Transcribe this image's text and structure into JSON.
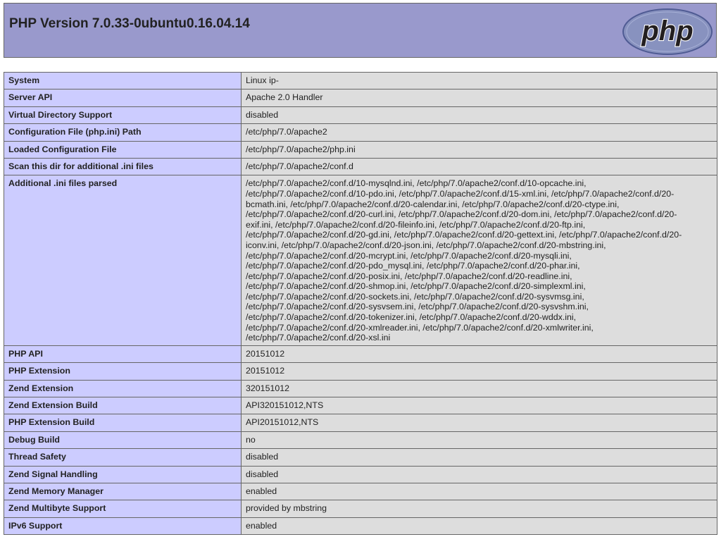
{
  "header": {
    "title": "PHP Version 7.0.33-0ubuntu0.16.04.14",
    "logo_text": "php",
    "colors": {
      "header_bg": "#9999cc",
      "label_bg": "#ccccff",
      "value_bg": "#dddddd",
      "border": "#666666"
    }
  },
  "info_rows": [
    {
      "label": "System",
      "value": "Linux ip-"
    },
    {
      "label": "Server API",
      "value": "Apache 2.0 Handler"
    },
    {
      "label": "Virtual Directory Support",
      "value": "disabled"
    },
    {
      "label": "Configuration File (php.ini) Path",
      "value": "/etc/php/7.0/apache2"
    },
    {
      "label": "Loaded Configuration File",
      "value": "/etc/php/7.0/apache2/php.ini"
    },
    {
      "label": "Scan this dir for additional .ini files",
      "value": "/etc/php/7.0/apache2/conf.d"
    },
    {
      "label": "Additional .ini files parsed",
      "lines": [
        "/etc/php/7.0/apache2/conf.d/10-mysqlnd.ini, /etc/php/7.0/apache2/conf.d/10-opcache.ini,",
        "/etc/php/7.0/apache2/conf.d/10-pdo.ini, /etc/php/7.0/apache2/conf.d/15-xml.ini, /etc/php/7.0/apache2/conf.d/20-",
        "bcmath.ini, /etc/php/7.0/apache2/conf.d/20-calendar.ini, /etc/php/7.0/apache2/conf.d/20-ctype.ini,",
        "/etc/php/7.0/apache2/conf.d/20-curl.ini, /etc/php/7.0/apache2/conf.d/20-dom.ini, /etc/php/7.0/apache2/conf.d/20-",
        "exif.ini, /etc/php/7.0/apache2/conf.d/20-fileinfo.ini, /etc/php/7.0/apache2/conf.d/20-ftp.ini,",
        "/etc/php/7.0/apache2/conf.d/20-gd.ini, /etc/php/7.0/apache2/conf.d/20-gettext.ini, /etc/php/7.0/apache2/conf.d/20-",
        "iconv.ini, /etc/php/7.0/apache2/conf.d/20-json.ini, /etc/php/7.0/apache2/conf.d/20-mbstring.ini,",
        "/etc/php/7.0/apache2/conf.d/20-mcrypt.ini, /etc/php/7.0/apache2/conf.d/20-mysqli.ini,",
        "/etc/php/7.0/apache2/conf.d/20-pdo_mysql.ini, /etc/php/7.0/apache2/conf.d/20-phar.ini,",
        "/etc/php/7.0/apache2/conf.d/20-posix.ini, /etc/php/7.0/apache2/conf.d/20-readline.ini,",
        "/etc/php/7.0/apache2/conf.d/20-shmop.ini, /etc/php/7.0/apache2/conf.d/20-simplexml.ini,",
        "/etc/php/7.0/apache2/conf.d/20-sockets.ini, /etc/php/7.0/apache2/conf.d/20-sysvmsg.ini,",
        "/etc/php/7.0/apache2/conf.d/20-sysvsem.ini, /etc/php/7.0/apache2/conf.d/20-sysvshm.ini,",
        "/etc/php/7.0/apache2/conf.d/20-tokenizer.ini, /etc/php/7.0/apache2/conf.d/20-wddx.ini,",
        "/etc/php/7.0/apache2/conf.d/20-xmlreader.ini, /etc/php/7.0/apache2/conf.d/20-xmlwriter.ini,",
        "/etc/php/7.0/apache2/conf.d/20-xsl.ini"
      ]
    },
    {
      "label": "PHP API",
      "value": "20151012"
    },
    {
      "label": "PHP Extension",
      "value": "20151012"
    },
    {
      "label": "Zend Extension",
      "value": "320151012"
    },
    {
      "label": "Zend Extension Build",
      "value": "API320151012,NTS"
    },
    {
      "label": "PHP Extension Build",
      "value": "API20151012,NTS"
    },
    {
      "label": "Debug Build",
      "value": "no"
    },
    {
      "label": "Thread Safety",
      "value": "disabled"
    },
    {
      "label": "Zend Signal Handling",
      "value": "disabled"
    },
    {
      "label": "Zend Memory Manager",
      "value": "enabled"
    },
    {
      "label": "Zend Multibyte Support",
      "value": "provided by mbstring"
    },
    {
      "label": "IPv6 Support",
      "value": "enabled"
    }
  ]
}
